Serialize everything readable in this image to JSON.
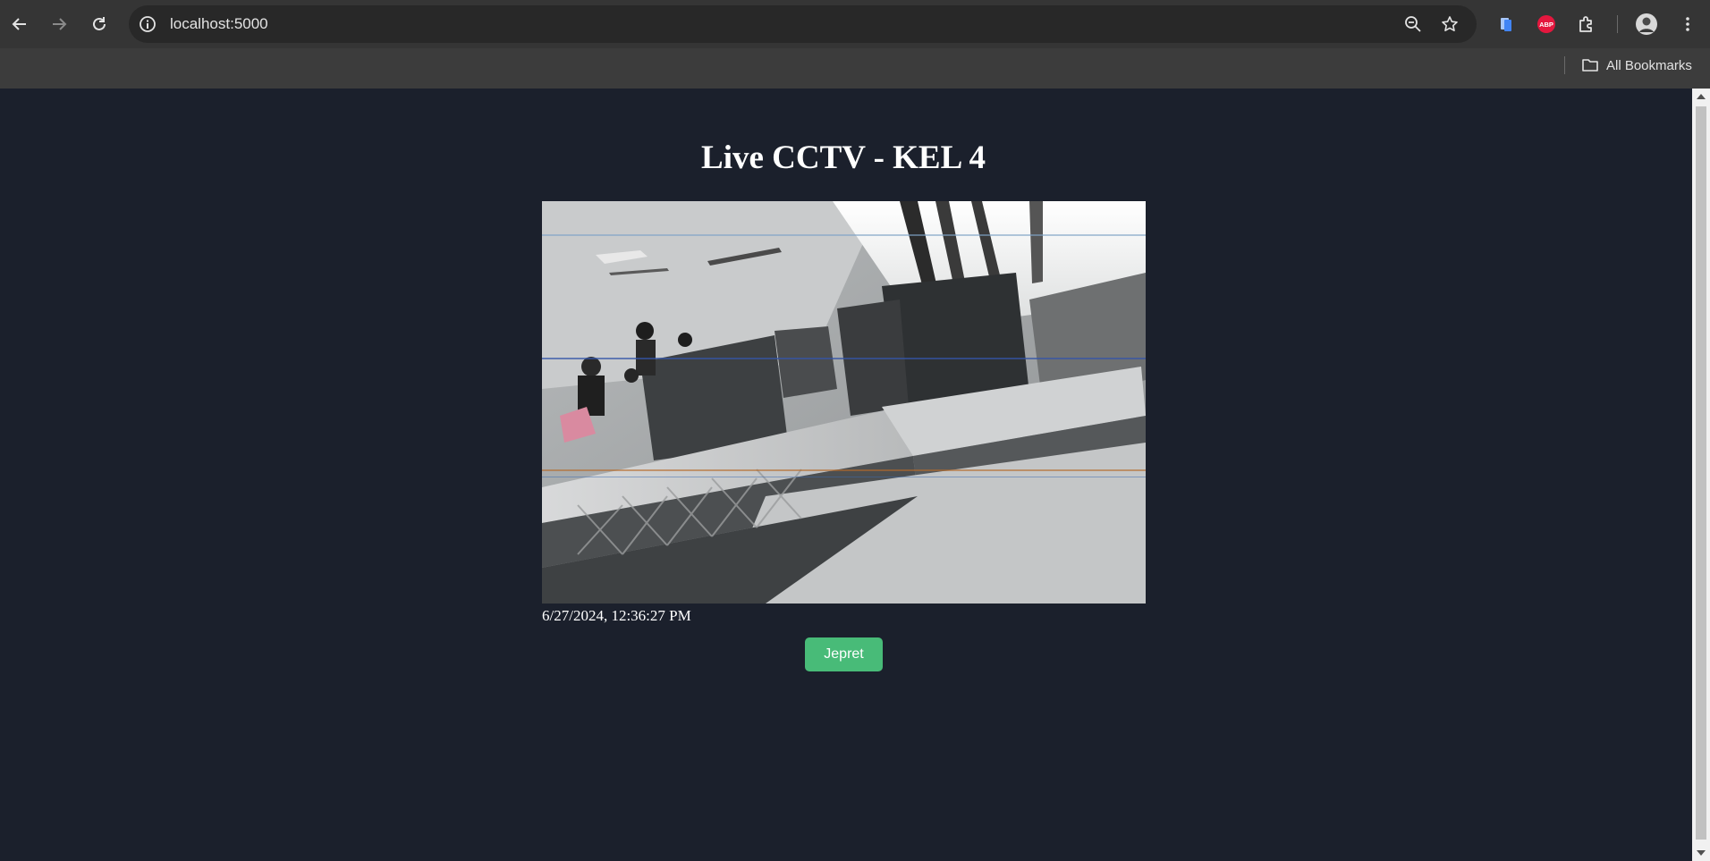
{
  "browser": {
    "url": "localhost:5000",
    "bookmarks_label": "All Bookmarks",
    "extension_abp_label": "ABP",
    "icons": [
      "back-icon",
      "forward-icon",
      "reload-icon",
      "site-info-icon",
      "zoom-icon",
      "star-icon",
      "extension-icon",
      "puzzle-icon",
      "avatar",
      "menu-icon",
      "folder-icon"
    ]
  },
  "page": {
    "title": "Live CCTV - KEL 4",
    "timestamp": "6/27/2024, 12:36:27 PM",
    "capture_button_label": "Jepret"
  },
  "colors": {
    "page_background": "#1b202c",
    "button": "#48bb78",
    "abp_badge": "#e4173e"
  }
}
